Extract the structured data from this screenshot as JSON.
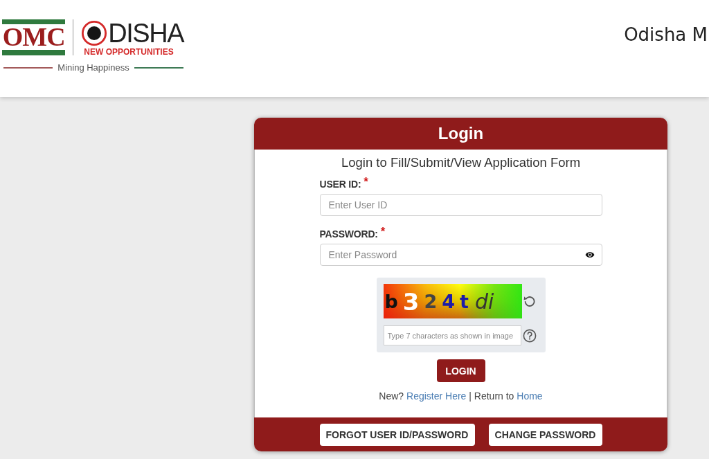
{
  "header": {
    "logo": {
      "omc": "OMC",
      "odisha": "DISHA",
      "tagline": "NEW OPPORTUNITIES",
      "motto": "Mining Happiness"
    },
    "title": "Odisha M"
  },
  "login_card": {
    "title": "Login",
    "subtitle": "Login to Fill/Submit/View Application Form",
    "fields": [
      {
        "kind": "text",
        "label": "USER ID:",
        "required_mark": "*",
        "placeholder": "Enter User ID"
      },
      {
        "kind": "password",
        "label": "PASSWORD:",
        "required_mark": "*",
        "placeholder": "Enter Password"
      }
    ],
    "captcha": {
      "glyphs": [
        {
          "text": "b",
          "kind": "bold",
          "color": "#111111"
        },
        {
          "text": "3",
          "kind": "large",
          "color": "#ffffff"
        },
        {
          "text": "2",
          "kind": "bold",
          "color": "#444444"
        },
        {
          "text": "4",
          "kind": "bold",
          "color": "#1c1ca8"
        },
        {
          "text": "t",
          "kind": "bold",
          "color": "#1c1ca8"
        },
        {
          "text": "di",
          "kind": "italic",
          "color": "#333333"
        }
      ],
      "placeholder": "Type 7 characters as shown in image"
    },
    "login_button": "LOGIN",
    "links_line": [
      {
        "kind": "text",
        "text": "New?"
      },
      {
        "kind": "link",
        "text": "Register Here"
      },
      {
        "kind": "text",
        "text": "| Return to"
      },
      {
        "kind": "link",
        "text": "Home"
      }
    ],
    "footer_buttons": [
      "FORGOT USER ID/PASSWORD",
      "CHANGE PASSWORD"
    ]
  }
}
